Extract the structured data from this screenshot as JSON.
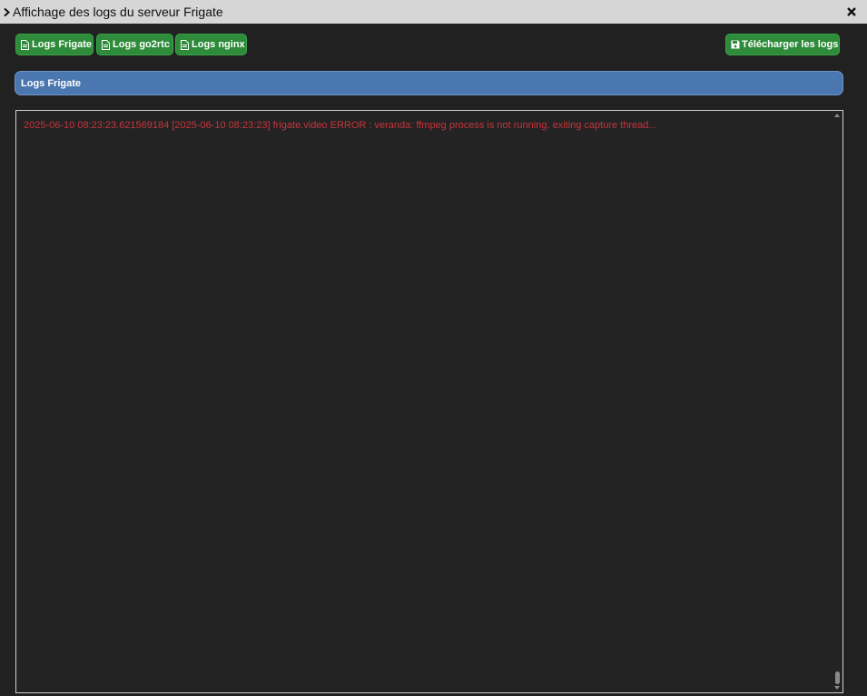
{
  "window": {
    "title": "Affichage des logs du serveur Frigate"
  },
  "toolbar": {
    "buttons": [
      {
        "label": "Logs Frigate",
        "icon": "file-icon"
      },
      {
        "label": "Logs go2rtc",
        "icon": "file-icon"
      },
      {
        "label": "Logs nginx",
        "icon": "file-icon"
      }
    ],
    "download": {
      "label": "Télécharger les logs",
      "icon": "save-icon"
    }
  },
  "panel": {
    "title": "Logs Frigate"
  },
  "log": {
    "lines": [
      "2025-06-10 08:23:23.621569184 [2025-06-10 08:23:23] frigate.video ERROR   : veranda: ffmpeg process is not running. exiting capture thread..."
    ]
  },
  "colors": {
    "titlebar": "#d6d6d6",
    "button_green": "#2e8b3a",
    "panel_blue": "#4b77b0",
    "error_text": "#c8343c",
    "background": "#212121"
  }
}
